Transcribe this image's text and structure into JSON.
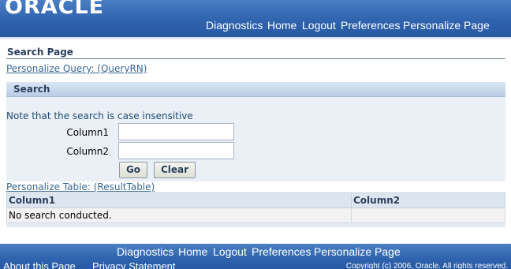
{
  "brand": {
    "logo": "ORACLE"
  },
  "header": {
    "nav": [
      "Diagnostics",
      "Home",
      "Logout",
      "Preferences",
      "Personalize Page"
    ]
  },
  "page": {
    "title": "Search Page",
    "personalize_query": "Personalize Query: (QueryRN)"
  },
  "search": {
    "header": "Search",
    "note": "Note that the search is case insensitive",
    "fields": [
      {
        "label": "Column1",
        "value": ""
      },
      {
        "label": "Column2",
        "value": ""
      }
    ],
    "go_label": "Go",
    "clear_label": "Clear"
  },
  "table": {
    "personalize_link": "Personalize Table: (ResultTable)",
    "columns": [
      "Column1",
      "Column2"
    ],
    "empty_message": "No search conducted."
  },
  "footer": {
    "nav": [
      "Diagnostics",
      "Home",
      "Logout",
      "Preferences",
      "Personalize Page"
    ],
    "about": "About this Page",
    "privacy": "Privacy Statement",
    "copyright": "Copyright (c) 2006, Oracle. All rights reserved."
  },
  "colors": {
    "header_blue": "#2f63ad",
    "link": "#3a6896",
    "region_bg": "#eaf0f6"
  }
}
